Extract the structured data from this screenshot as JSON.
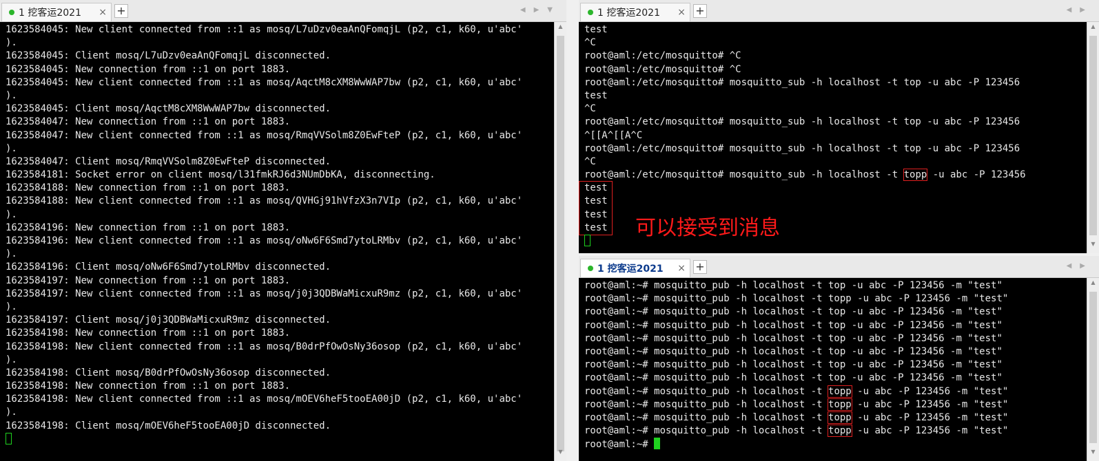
{
  "tabs": {
    "left": {
      "label": "1 挖客运2021",
      "close": "×",
      "add": "+"
    },
    "top_right": {
      "label": "1 挖客运2021",
      "close": "×",
      "add": "+"
    },
    "bottom_right": {
      "label": "1 挖客运2021",
      "close": "×",
      "add": "+"
    }
  },
  "left_terminal": {
    "lines": [
      "1623584045: New client connected from ::1 as mosq/L7uDzv0eaAnQFomqjL (p2, c1, k60, u'abc'",
      ").",
      "1623584045: Client mosq/L7uDzv0eaAnQFomqjL disconnected.",
      "1623584045: New connection from ::1 on port 1883.",
      "1623584045: New client connected from ::1 as mosq/AqctM8cXM8WwWAP7bw (p2, c1, k60, u'abc'",
      ").",
      "1623584045: Client mosq/AqctM8cXM8WwWAP7bw disconnected.",
      "1623584047: New connection from ::1 on port 1883.",
      "1623584047: New client connected from ::1 as mosq/RmqVVSolm8Z0EwFteP (p2, c1, k60, u'abc'",
      ").",
      "1623584047: Client mosq/RmqVVSolm8Z0EwFteP disconnected.",
      "1623584181: Socket error on client mosq/l31fmkRJ6d3NUmDbKA, disconnecting.",
      "1623584188: New connection from ::1 on port 1883.",
      "1623584188: New client connected from ::1 as mosq/QVHGj91hVfzX3n7VIp (p2, c1, k60, u'abc'",
      ").",
      "1623584196: New connection from ::1 on port 1883.",
      "1623584196: New client connected from ::1 as mosq/oNw6F6Smd7ytoLRMbv (p2, c1, k60, u'abc'",
      ").",
      "1623584196: Client mosq/oNw6F6Smd7ytoLRMbv disconnected.",
      "1623584197: New connection from ::1 on port 1883.",
      "1623584197: New client connected from ::1 as mosq/j0j3QDBWaMicxuR9mz (p2, c1, k60, u'abc'",
      ").",
      "1623584197: Client mosq/j0j3QDBWaMicxuR9mz disconnected.",
      "1623584198: New connection from ::1 on port 1883.",
      "1623584198: New client connected from ::1 as mosq/B0drPfOwOsNy36osop (p2, c1, k60, u'abc'",
      ").",
      "1623584198: Client mosq/B0drPfOwOsNy36osop disconnected.",
      "1623584198: New connection from ::1 on port 1883.",
      "1623584198: New client connected from ::1 as mosq/mOEV6heF5tooEA00jD (p2, c1, k60, u'abc'",
      ").",
      "1623584198: Client mosq/mOEV6heF5tooEA00jD disconnected."
    ]
  },
  "top_right_terminal": {
    "lines": [
      "test",
      "^C",
      "root@aml:/etc/mosquitto# ^C",
      "root@aml:/etc/mosquitto# ^C",
      "root@aml:/etc/mosquitto# mosquitto_sub -h localhost -t top -u abc -P 123456",
      "test",
      "^C",
      "root@aml:/etc/mosquitto# mosquitto_sub -h localhost -t top -u abc -P 123456",
      "^[[A^[[A^C",
      "root@aml:/etc/mosquitto# mosquitto_sub -h localhost -t top -u abc -P 123456",
      "^C"
    ],
    "topp_cmd": {
      "before": "root@aml:/etc/mosquitto# mosquitto_sub -h localhost -t ",
      "topic": "topp",
      "after": " -u abc -P 123456"
    },
    "received": [
      "test",
      "test",
      "test",
      "test"
    ]
  },
  "annotation": "可以接受到消息",
  "bottom_right_terminal": {
    "top_lines": [
      "root@aml:~# mosquitto_pub -h localhost -t top -u abc -P 123456 -m \"test\"",
      "root@aml:~# mosquitto_pub -h localhost -t topp -u abc -P 123456 -m \"test\"",
      "root@aml:~# mosquitto_pub -h localhost -t top -u abc -P 123456 -m \"test\"",
      "root@aml:~# mosquitto_pub -h localhost -t top -u abc -P 123456 -m \"test\"",
      "root@aml:~# mosquitto_pub -h localhost -t top -u abc -P 123456 -m \"test\"",
      "root@aml:~# mosquitto_pub -h localhost -t top -u abc -P 123456 -m \"test\"",
      "root@aml:~# mosquitto_pub -h localhost -t top -u abc -P 123456 -m \"test\"",
      "root@aml:~# mosquitto_pub -h localhost -t top -u abc -P 123456 -m \"test\""
    ],
    "topp_before": "root@aml:~# mosquitto_pub -h localhost -t ",
    "topp_topic": "topp",
    "topp_after": " -u abc -P 123456 -m \"test\"",
    "topp_count": 4,
    "prompt": "root@aml:~# "
  },
  "colors": {
    "terminal_bg": "#000000",
    "terminal_fg": "#e8e8e8",
    "cursor": "#1fd21f",
    "highlight": "#e02020",
    "tab_dot": "#2bb52b"
  }
}
